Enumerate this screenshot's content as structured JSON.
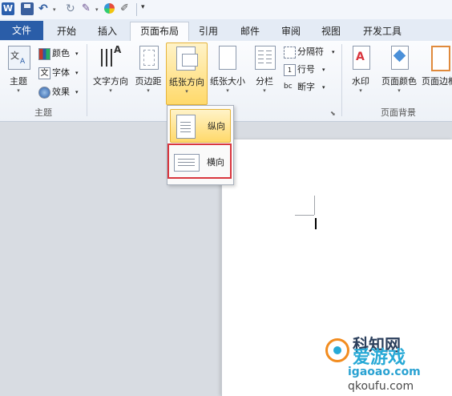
{
  "qat": {
    "word_logo": "W"
  },
  "tabs": [
    "文件",
    "开始",
    "插入",
    "页面布局",
    "引用",
    "邮件",
    "审阅",
    "视图",
    "开发工具"
  ],
  "ribbon": {
    "theme_group": {
      "themes_label": "主题",
      "colors_label": "颜色",
      "fonts_label": "字体",
      "effects_label": "效果",
      "group_label": "主题"
    },
    "page_setup_group": {
      "text_direction_label": "文字方向",
      "margins_label": "页边距",
      "orientation_label": "纸张方向",
      "size_label": "纸张大小",
      "columns_label": "分栏",
      "breaks_label": "分隔符",
      "line_numbers_label": "行号",
      "hyphenation_label": "断字"
    },
    "page_background_group": {
      "watermark_label": "水印",
      "page_color_label": "页面颜色",
      "page_borders_label": "页面边框",
      "group_label": "页面背景"
    }
  },
  "orientation_menu": {
    "portrait_label": "纵向",
    "landscape_label": "横向"
  },
  "watermark": {
    "title": "科知网",
    "brand": "爱游戏",
    "url1": "igaoao.com",
    "url2": "qkoufu.com"
  },
  "colors": {
    "file_tab": "#2a5da8",
    "highlight": "#ffd96a",
    "red_box": "#d9363e"
  }
}
